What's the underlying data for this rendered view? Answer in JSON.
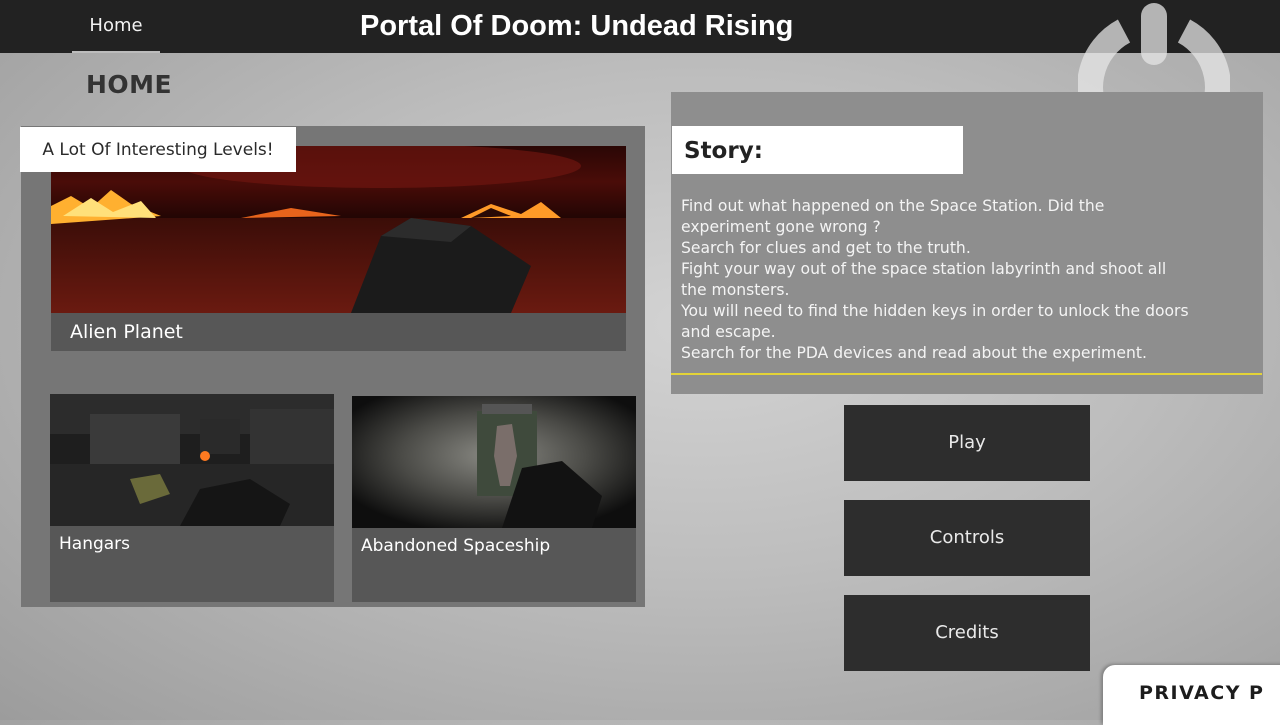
{
  "header": {
    "home_tab": "Home",
    "title": "Portal Of Doom: Undead Rising"
  },
  "section_title": "HOME",
  "levels": {
    "tag": "A Lot Of Interesting Levels!",
    "items": [
      {
        "label": "Alien Planet"
      },
      {
        "label": "Hangars"
      },
      {
        "label": "Abandoned Spaceship"
      }
    ]
  },
  "story": {
    "heading": "Story:",
    "lines": [
      "Find out what happened on the Space Station. Did the",
      "experiment gone wrong ?",
      "Search for clues and get to the truth.",
      "Fight your way out of the space station labyrinth and shoot all",
      "the monsters.",
      "You will need to find the hidden keys in order to unlock the doors",
      "and escape.",
      "Search for the PDA devices and read about the experiment."
    ]
  },
  "menu": {
    "play": "Play",
    "controls": "Controls",
    "credits": "Credits"
  },
  "privacy": "PRIVACY P",
  "icons": {
    "power": "power-icon"
  }
}
